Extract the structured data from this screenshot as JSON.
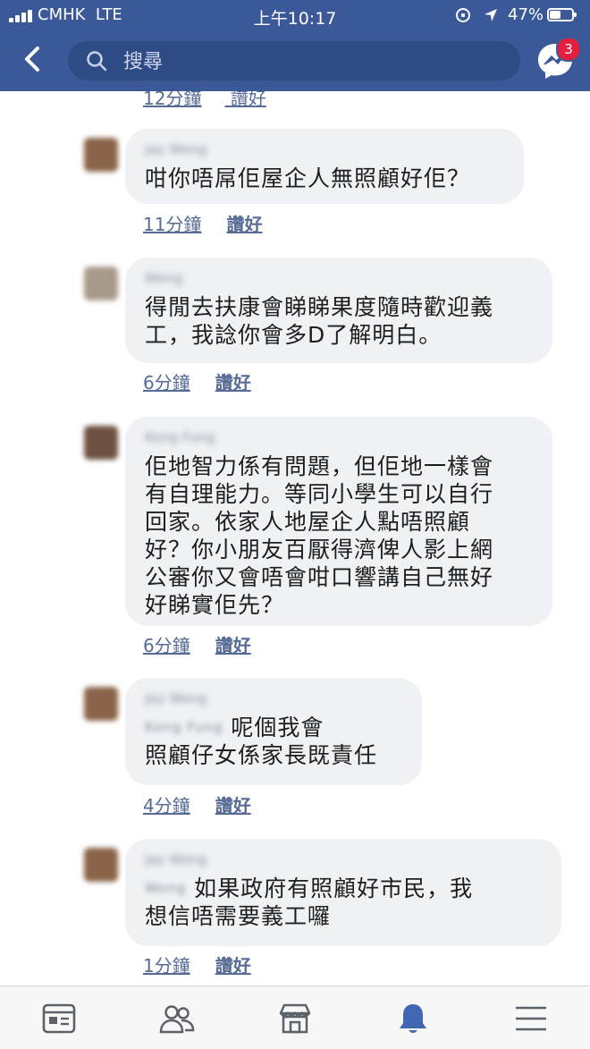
{
  "status_bar": {
    "carrier": "CMHK",
    "network": "LTE",
    "time": "上午10:17",
    "battery": "47%"
  },
  "header": {
    "search_placeholder": "搜尋",
    "messenger_badge": "3",
    "accent_color": "#3b5998"
  },
  "partial_meta": {
    "time": "12分鐘",
    "like": "讚好"
  },
  "comments": [
    {
      "author": "Jay Wong",
      "mention": "",
      "text": "咁你唔屌佢屋企人無照顧好佢？",
      "time": "11分鐘",
      "like": "讚好"
    },
    {
      "author": "Wong",
      "mention": "",
      "text": "得閒去扶康會睇睇果度隨時歡迎義\n工，我諗你會多D了解明白。",
      "time": "6分鐘",
      "like": "讚好"
    },
    {
      "author": "Kong Fung",
      "mention": "",
      "text": "佢地智力係有問題，但佢地一樣會\n有自理能力。等同小學生可以自行\n回家。依家人地屋企人點唔照顧\n好？你小朋友百厭得濟俾人影上網\n公審你又會唔會咁口響講自己無好\n好睇實佢先？",
      "time": "6分鐘",
      "like": "讚好"
    },
    {
      "author": "Jay Wong",
      "mention": "Kong Fung",
      "text": "呢個我會\n照顧仔女係家長既責任",
      "time": "4分鐘",
      "like": "讚好"
    },
    {
      "author": "Jay Wong",
      "mention": "Wong",
      "text": "如果政府有照顧好市民，我\n想信唔需要義工囉",
      "time": "1分鐘",
      "like": "讚好"
    }
  ],
  "tabbar": {
    "tabs": [
      {
        "icon": "news-feed-icon"
      },
      {
        "icon": "friends-icon"
      },
      {
        "icon": "marketplace-icon"
      },
      {
        "icon": "notifications-bell-icon",
        "active": true
      },
      {
        "icon": "menu-icon"
      }
    ],
    "active_color": "#4267b2",
    "inactive_color": "#5d6168"
  }
}
